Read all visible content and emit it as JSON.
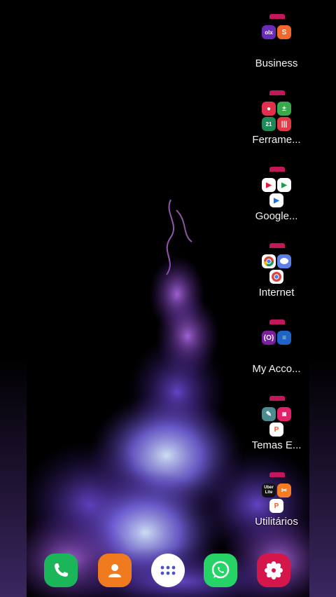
{
  "folders": [
    {
      "label": "Business",
      "icons": [
        "olx-icon",
        "shopee-icon"
      ]
    },
    {
      "label": "Ferrame...",
      "icons": [
        "screen-recorder-icon",
        "calculator-icon",
        "calendar-icon",
        "voice-recorder-icon"
      ]
    },
    {
      "label": "Google...",
      "icons": [
        "youtube-icon",
        "play-games-icon",
        "play-store-icon"
      ]
    },
    {
      "label": "Internet",
      "icons": [
        "chrome-icon",
        "messages-icon",
        "chrome-alt-icon"
      ]
    },
    {
      "label": "My Acco...",
      "icons": [
        "nubank-icon",
        "bb-icon"
      ]
    },
    {
      "label": "Temas E...",
      "icons": [
        "galaxy-themes-icon",
        "galaxy-store-icon",
        "picpay-icon"
      ]
    },
    {
      "label": "Utilitários",
      "icons": [
        "uber-lite-icon",
        "tools-icon",
        "picpay-icon"
      ],
      "uber_text": "Uber\nLite"
    }
  ],
  "dock": [
    "phone-icon",
    "contacts-icon",
    "apps-drawer-icon",
    "whatsapp-icon",
    "gallery-icon"
  ],
  "colors": {
    "accent": "#c2185b",
    "phone": "#1bb55a",
    "contacts": "#f07b1f",
    "whatsapp": "#25d366",
    "gallery": "#d5164b"
  }
}
